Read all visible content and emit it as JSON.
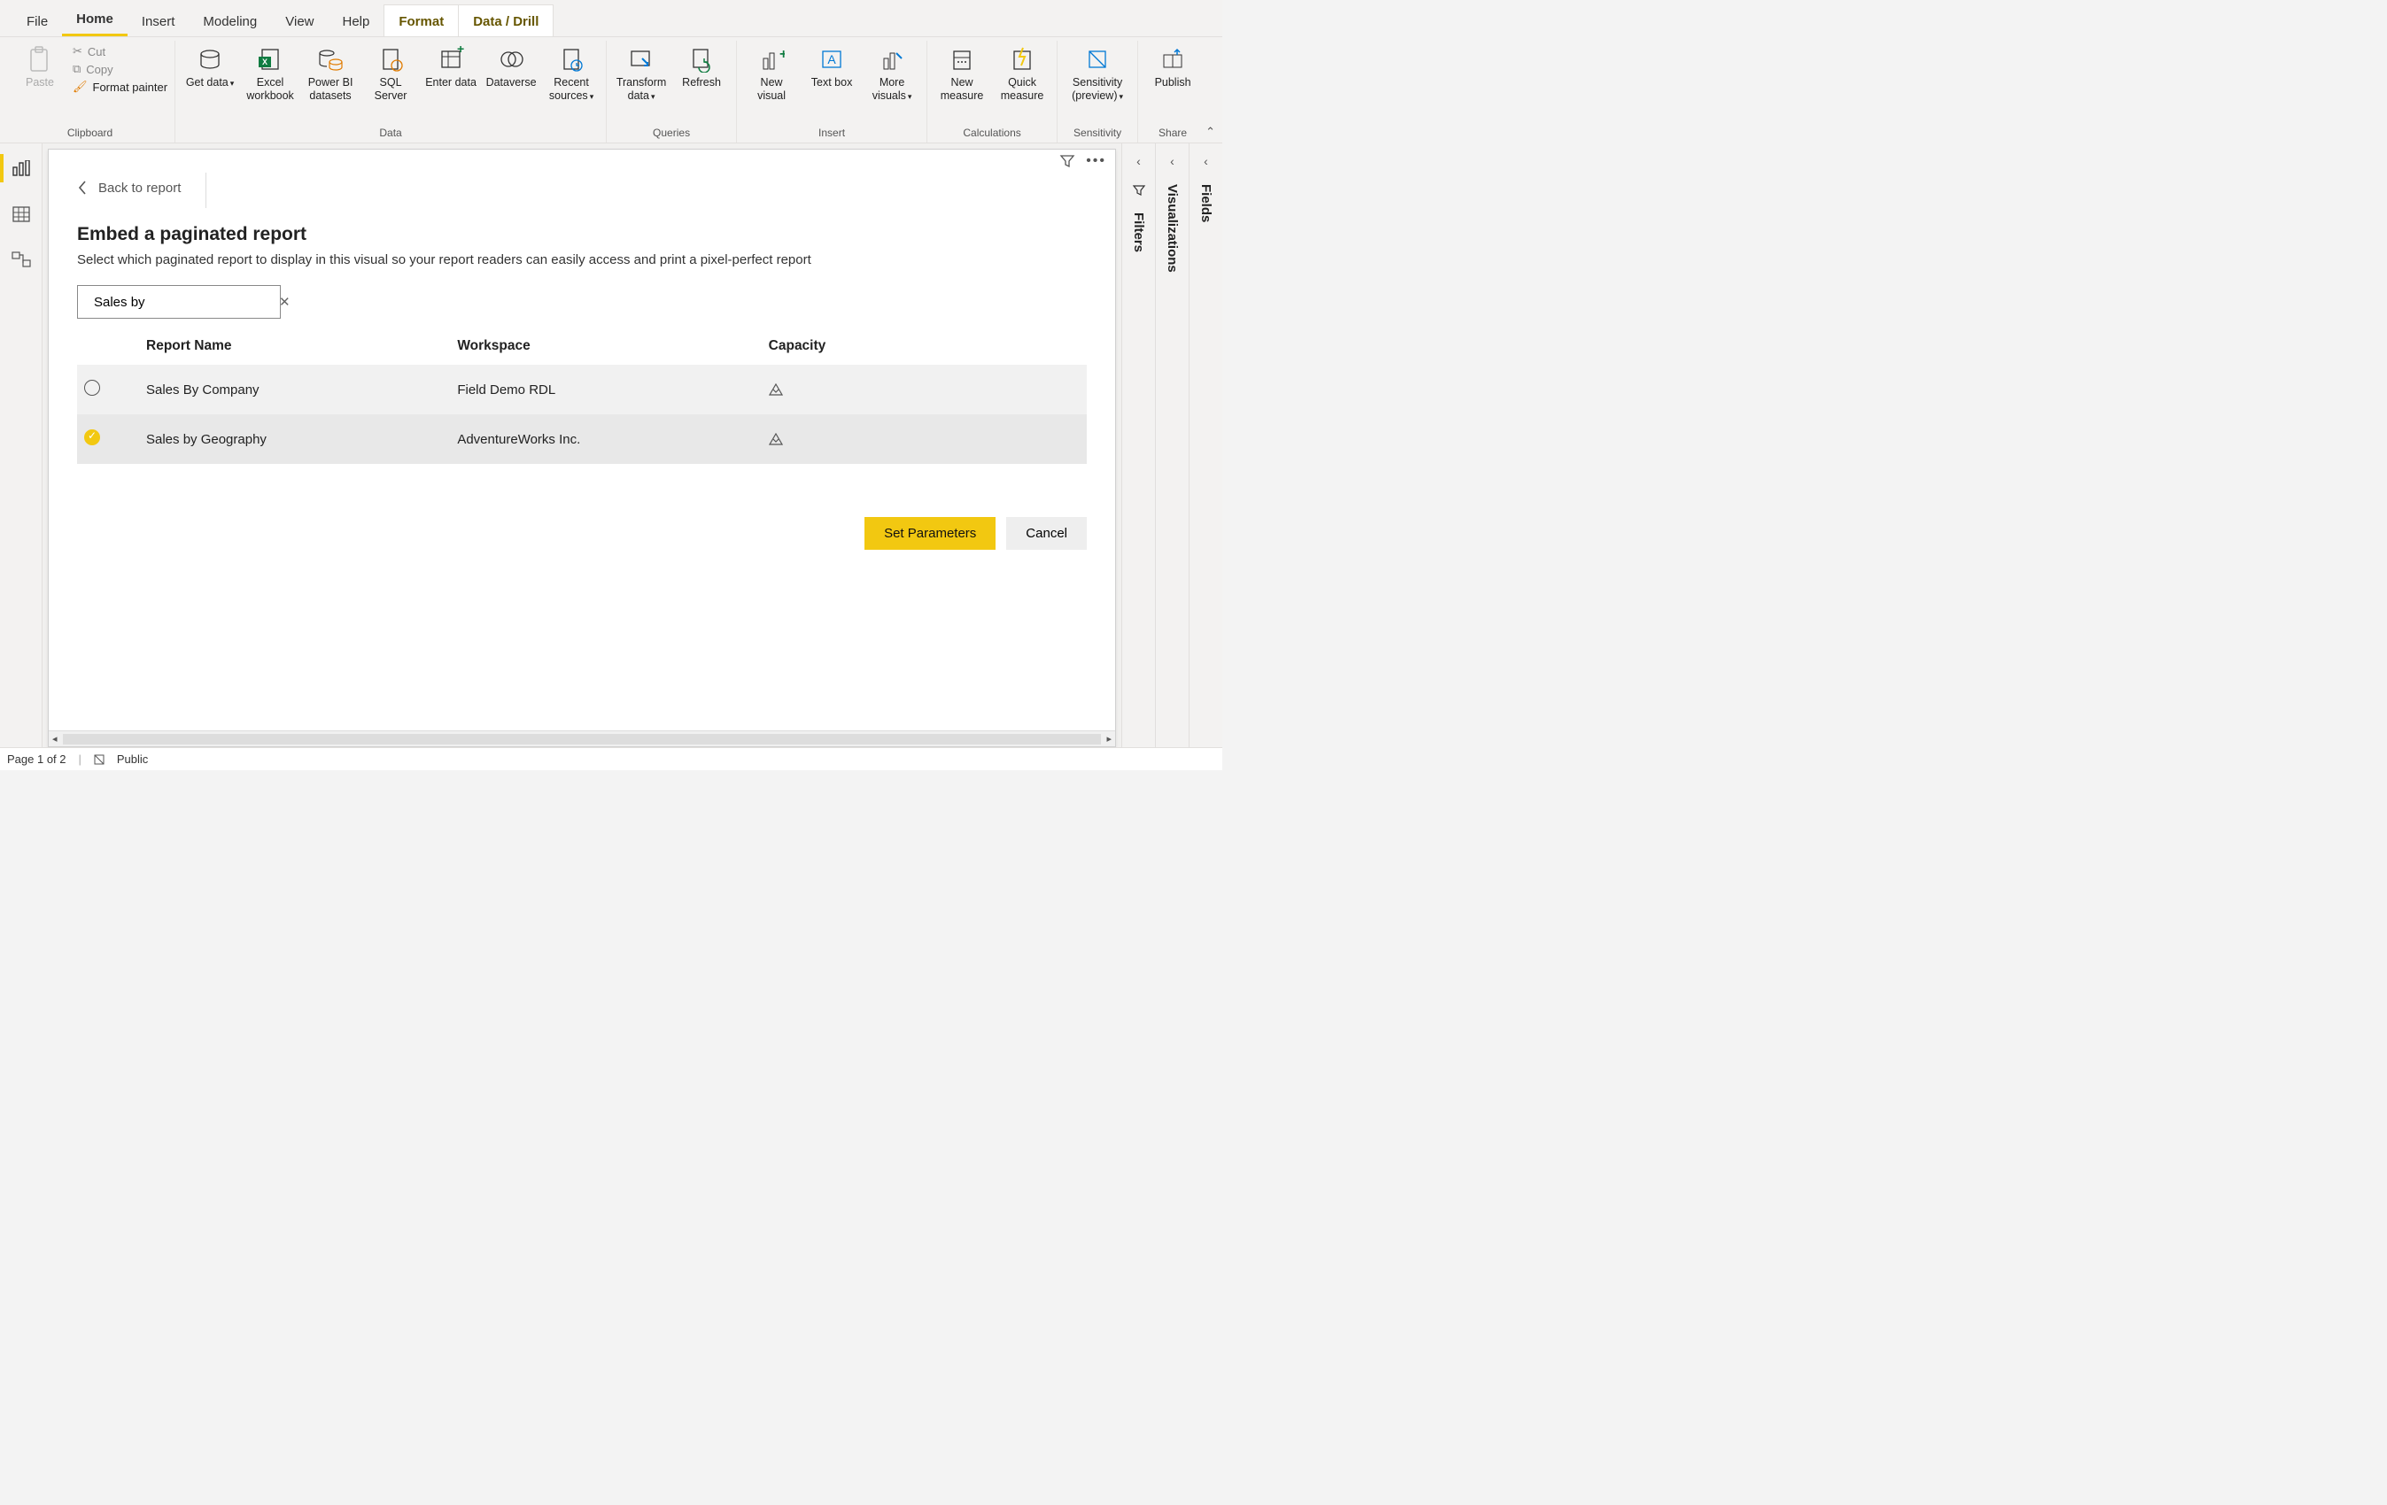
{
  "menu": {
    "items": [
      "File",
      "Home",
      "Insert",
      "Modeling",
      "View",
      "Help"
    ],
    "active": "Home",
    "context": [
      "Format",
      "Data / Drill"
    ]
  },
  "ribbon": {
    "clipboard": {
      "label": "Clipboard",
      "paste": "Paste",
      "cut": "Cut",
      "copy": "Copy",
      "format_painter": "Format painter"
    },
    "data": {
      "label": "Data",
      "buttons": [
        {
          "label": "Get data",
          "caret": true
        },
        {
          "label": "Excel workbook"
        },
        {
          "label": "Power BI datasets"
        },
        {
          "label": "SQL Server"
        },
        {
          "label": "Enter data"
        },
        {
          "label": "Dataverse"
        },
        {
          "label": "Recent sources",
          "caret": true
        }
      ]
    },
    "queries": {
      "label": "Queries",
      "buttons": [
        {
          "label": "Transform data",
          "caret": true
        },
        {
          "label": "Refresh"
        }
      ]
    },
    "insert": {
      "label": "Insert",
      "buttons": [
        {
          "label": "New visual"
        },
        {
          "label": "Text box"
        },
        {
          "label": "More visuals",
          "caret": true
        }
      ]
    },
    "calculations": {
      "label": "Calculations",
      "buttons": [
        {
          "label": "New measure"
        },
        {
          "label": "Quick measure"
        }
      ]
    },
    "sensitivity": {
      "label": "Sensitivity",
      "buttons": [
        {
          "label": "Sensitivity (preview)",
          "caret": true
        }
      ]
    },
    "share": {
      "label": "Share",
      "buttons": [
        {
          "label": "Publish"
        }
      ]
    }
  },
  "panes": {
    "filters": "Filters",
    "visualizations": "Visualizations",
    "fields": "Fields"
  },
  "visual": {
    "back": "Back to report",
    "title": "Embed a paginated report",
    "subtitle": "Select which paginated report to display in this visual so your report readers can easily access and print a pixel-perfect report",
    "search_value": "Sales by",
    "columns": {
      "name": "Report Name",
      "workspace": "Workspace",
      "capacity": "Capacity"
    },
    "rows": [
      {
        "name": "Sales By Company",
        "workspace": "Field Demo RDL",
        "selected": false
      },
      {
        "name": "Sales by Geography",
        "workspace": "AdventureWorks Inc.",
        "selected": true
      }
    ],
    "set_parameters": "Set Parameters",
    "cancel": "Cancel"
  },
  "status": {
    "page": "Page 1 of 2",
    "sensitivity": "Public"
  }
}
